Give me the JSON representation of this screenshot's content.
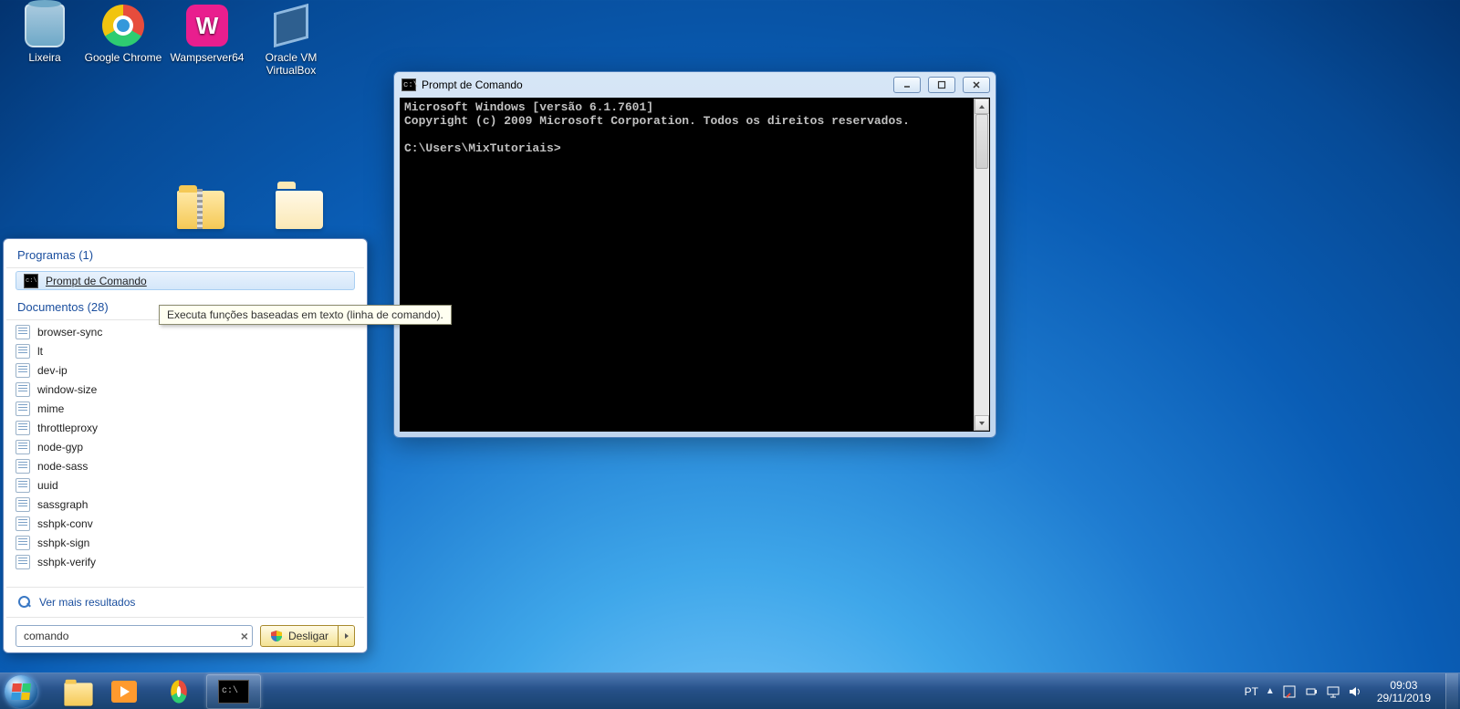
{
  "desktop_icons": {
    "recycle": "Lixeira",
    "chrome": "Google Chrome",
    "wamp": "Wampserver64",
    "vbox_l1": "Oracle VM",
    "vbox_l2": "VirtualBox"
  },
  "cmd_window": {
    "title": "Prompt de Comando",
    "line1": "Microsoft Windows [versão 6.1.7601]",
    "line2": "Copyright (c) 2009 Microsoft Corporation. Todos os direitos reservados.",
    "prompt": "C:\\Users\\MixTutoriais>"
  },
  "start_menu": {
    "programs_header": "Programas (1)",
    "programs": {
      "item1": "Prompt de Comando"
    },
    "documents_header": "Documentos (28)",
    "documents": {
      "d1": "browser-sync",
      "d2": "lt",
      "d3": "dev-ip",
      "d4": "window-size",
      "d5": "mime",
      "d6": "throttleproxy",
      "d7": "node-gyp",
      "d8": "node-sass",
      "d9": "uuid",
      "d10": "sassgraph",
      "d11": "sshpk-conv",
      "d12": "sshpk-sign",
      "d13": "sshpk-verify"
    },
    "more_results": "Ver mais resultados",
    "search_text": "comando",
    "shutdown_label": "Desligar",
    "tooltip": "Executa funções baseadas em texto (linha de comando)."
  },
  "taskbar": {
    "lang": "PT",
    "time": "09:03",
    "date": "29/11/2019"
  }
}
